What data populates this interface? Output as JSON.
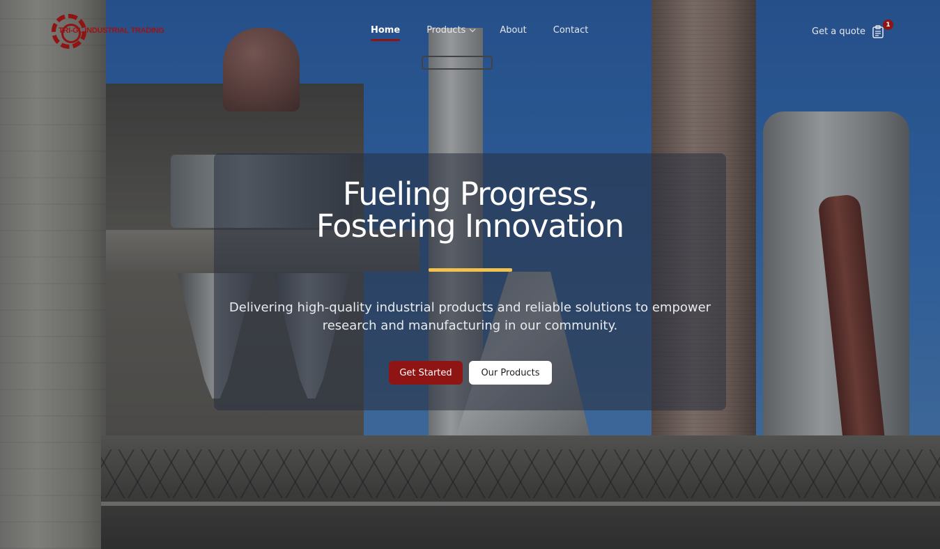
{
  "brand": {
    "name": "TRI-GL INDUSTRIAL TRADING",
    "logo_icon": "gear-icon",
    "accent_color": "#8f1414"
  },
  "nav": {
    "items": [
      {
        "label": "Home",
        "active": true
      },
      {
        "label": "Products",
        "has_dropdown": true
      },
      {
        "label": "About"
      },
      {
        "label": "Contact"
      }
    ]
  },
  "quote": {
    "label": "Get a quote",
    "icon": "clipboard-icon",
    "badge_count": "1"
  },
  "hero": {
    "title_line1": "Fueling Progress,",
    "title_line2": "Fostering Innovation",
    "rule_color": "#f2c14e",
    "subtitle": "Delivering high-quality industrial products and reliable solutions to empower research and manufacturing in our community.",
    "primary_button": "Get Started",
    "secondary_button": "Our Products"
  }
}
